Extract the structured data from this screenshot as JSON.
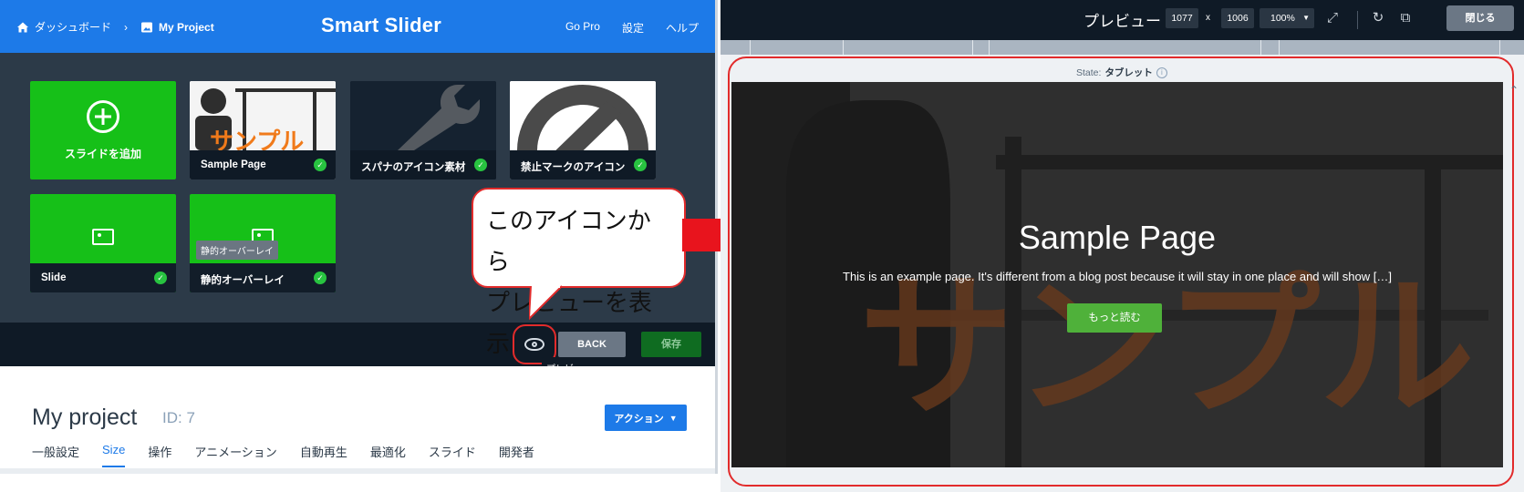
{
  "left": {
    "breadcrumb": {
      "dashboard": "ダッシュボード",
      "project": "My Project"
    },
    "brand": "Smart Slider",
    "top_links": [
      "Go Pro",
      "設定",
      "ヘルプ"
    ],
    "slides": [
      {
        "label": "スライドを追加"
      },
      {
        "label": "Sample Page"
      },
      {
        "label": "スパナのアイコン素材"
      },
      {
        "label": "禁止マークのアイコン"
      },
      {
        "label": "Slide"
      },
      {
        "label": "静的オーバーレイ"
      }
    ],
    "static_overlay_tag": "静的オーバーレイ",
    "back_label": "BACK",
    "save_label": "保存",
    "preview_tooltip": "プレビュー",
    "project_title": "My project",
    "project_id": "ID: 7",
    "action_label": "アクション",
    "tabs": [
      "一般設定",
      "Size",
      "操作",
      "アニメーション",
      "自動再生",
      "最適化",
      "スライド",
      "開発者"
    ]
  },
  "callout": {
    "line1": "このアイコンから",
    "line2": "プレビューを表示"
  },
  "right": {
    "title": "プレビュー",
    "width": "1077",
    "x_label": "x",
    "height": "1006",
    "zoom": "100%",
    "close_label": "閉じる",
    "state_prefix": "State:",
    "state_value": "タブレット",
    "slide_thumb_text": "サンプル",
    "slide_title": "Sample Page",
    "slide_text": "This is an example page. It's different from a blog post because it will stay in one place and will show […]",
    "read_more": "もっと読む"
  },
  "colors": {
    "accent": "#1d7ae8",
    "green": "#16c018",
    "callout_red": "#e22b2b",
    "dark": "#0f1a26"
  }
}
